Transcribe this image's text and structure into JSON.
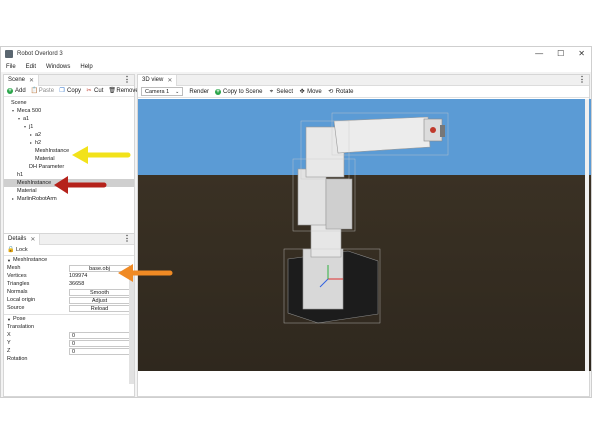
{
  "window": {
    "title": "Robot Overlord 3",
    "minimize": "—",
    "maximize": "☐",
    "close": "✕"
  },
  "menu": [
    "File",
    "Edit",
    "Windows",
    "Help"
  ],
  "scene_panel": {
    "tab_label": "Scene",
    "toolbar": {
      "add": "Add",
      "paste": "Paste",
      "copy": "Copy",
      "cut": "Cut",
      "remove": "Remove"
    },
    "tree": [
      {
        "label": "Scene",
        "depth": 0,
        "caret": ""
      },
      {
        "label": "Meca 500",
        "depth": 1,
        "caret": "▾"
      },
      {
        "label": "a1",
        "depth": 2,
        "caret": "▾"
      },
      {
        "label": "j1",
        "depth": 3,
        "caret": "▾"
      },
      {
        "label": "a2",
        "depth": 4,
        "caret": "▸"
      },
      {
        "label": "h2",
        "depth": 4,
        "caret": "▸"
      },
      {
        "label": "MeshInstance",
        "depth": 4,
        "caret": ""
      },
      {
        "label": "Material",
        "depth": 4,
        "caret": ""
      },
      {
        "label": "DH Parameter",
        "depth": 3,
        "caret": ""
      },
      {
        "label": "h1",
        "depth": 1,
        "caret": ""
      },
      {
        "label": "MeshInstance",
        "depth": 1,
        "caret": "",
        "selected": true
      },
      {
        "label": "Material",
        "depth": 1,
        "caret": ""
      },
      {
        "label": "MarlinRobotArm",
        "depth": 1,
        "caret": "▸"
      }
    ]
  },
  "details_panel": {
    "tab_label": "Details",
    "lock_label": "Lock",
    "mesh_section": "MeshInstance",
    "rows": {
      "mesh": {
        "label": "Mesh",
        "value": "base.obj"
      },
      "vertices": {
        "label": "Vertices",
        "value": "109974"
      },
      "triangles": {
        "label": "Triangles",
        "value": "36658"
      },
      "normals": {
        "label": "Normals",
        "button": "Smooth"
      },
      "local_origin": {
        "label": "Local origin",
        "button": "Adjust"
      },
      "source": {
        "label": "Source",
        "button": "Reload"
      }
    },
    "pose_section": "Pose",
    "translation_label": "Translation",
    "translation": {
      "x_label": "X",
      "x": "0",
      "y_label": "Y",
      "y": "0",
      "z_label": "Z",
      "z": "0"
    },
    "rotation_label": "Rotation"
  },
  "view_panel": {
    "tab_label": "3D view",
    "camera": "Camera 1",
    "render": "Render",
    "copy_to_scene": "Copy to Scene",
    "select": "Select",
    "move": "Move",
    "rotate": "Rotate"
  },
  "colors": {
    "sky": "#5b9bd5",
    "ground": "#3d3428",
    "selection": "#cfcfcf",
    "arrow_yellow": "#f2e21a",
    "arrow_red": "#b5221b",
    "arrow_orange": "#f08a24"
  }
}
